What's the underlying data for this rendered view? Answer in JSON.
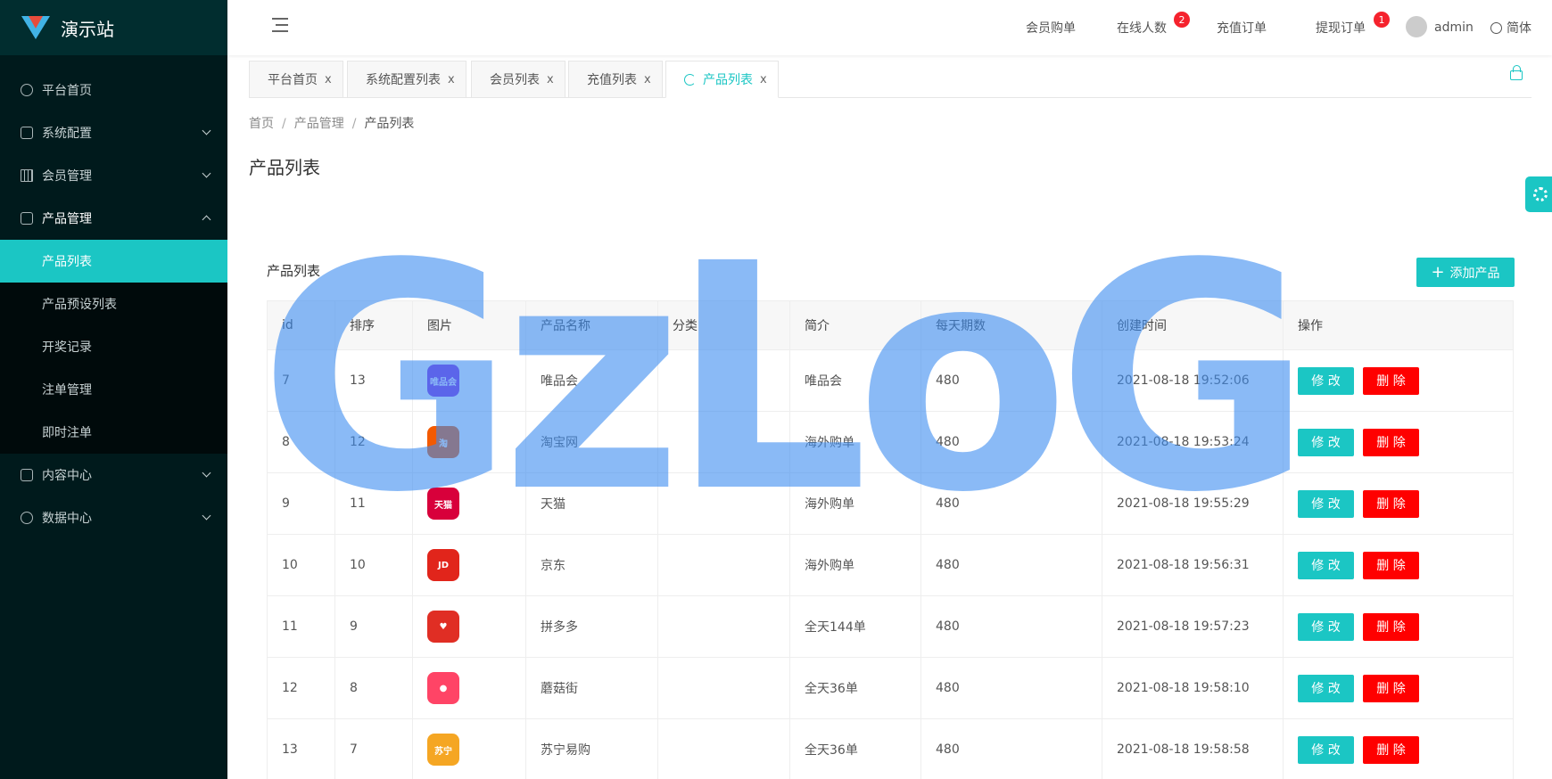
{
  "app": {
    "title": "演示站"
  },
  "sidebar": {
    "items": [
      {
        "label": "平台首页"
      },
      {
        "label": "系统配置"
      },
      {
        "label": "会员管理"
      },
      {
        "label": "产品管理"
      },
      {
        "label": "内容中心"
      },
      {
        "label": "数据中心"
      }
    ],
    "sub_items": [
      {
        "label": "产品列表"
      },
      {
        "label": "产品预设列表"
      },
      {
        "label": "开奖记录"
      },
      {
        "label": "注单管理"
      },
      {
        "label": "即时注单"
      }
    ]
  },
  "topbar": {
    "member_orders": "会员购单",
    "online_users": "在线人数",
    "online_badge": "2",
    "recharge_orders": "充值订单",
    "withdraw_orders": "提现订单",
    "withdraw_badge": "1",
    "user": "admin",
    "language": "简体"
  },
  "tabs": [
    {
      "label": "平台首页"
    },
    {
      "label": "系统配置列表"
    },
    {
      "label": "会员列表"
    },
    {
      "label": "充值列表"
    },
    {
      "label": "产品列表"
    }
  ],
  "tab_close": "x",
  "breadcrumb": {
    "home": "首页",
    "section": "产品管理",
    "current": "产品列表",
    "sep": "/"
  },
  "page_title": "产品列表",
  "card": {
    "title": "产品列表",
    "add_button": "添加产品",
    "add_icon": "+"
  },
  "table": {
    "columns": [
      "id",
      "排序",
      "图片",
      "产品名称",
      "分类",
      "简介",
      "每天期数",
      "创建时间",
      "操作"
    ],
    "edit_label": "修 改",
    "delete_label": "删 除",
    "rows": [
      {
        "id": "7",
        "sort": "13",
        "name": "唯品会",
        "category": "",
        "intro": "唯品会",
        "periods": "480",
        "created": "2021-08-18 19:52:06",
        "icon_text": "唯品会",
        "icon_color": "#8a2be2"
      },
      {
        "id": "8",
        "sort": "12",
        "name": "淘宝网",
        "category": "",
        "intro": "海外购单",
        "periods": "480",
        "created": "2021-08-18 19:53:24",
        "icon_text": "淘",
        "icon_color": "#f35a00"
      },
      {
        "id": "9",
        "sort": "11",
        "name": "天猫",
        "category": "",
        "intro": "海外购单",
        "periods": "480",
        "created": "2021-08-18 19:55:29",
        "icon_text": "天猫",
        "icon_color": "#d8003b"
      },
      {
        "id": "10",
        "sort": "10",
        "name": "京东",
        "category": "",
        "intro": "海外购单",
        "periods": "480",
        "created": "2021-08-18 19:56:31",
        "icon_text": "JD",
        "icon_color": "#e1251b"
      },
      {
        "id": "11",
        "sort": "9",
        "name": "拼多多",
        "category": "",
        "intro": "全天144单",
        "periods": "480",
        "created": "2021-08-18 19:57:23",
        "icon_text": "♥",
        "icon_color": "#e02e24"
      },
      {
        "id": "12",
        "sort": "8",
        "name": "蘑菇街",
        "category": "",
        "intro": "全天36单",
        "periods": "480",
        "created": "2021-08-18 19:58:10",
        "icon_text": "●",
        "icon_color": "#ff4466"
      },
      {
        "id": "13",
        "sort": "7",
        "name": "苏宁易购",
        "category": "",
        "intro": "全天36单",
        "periods": "480",
        "created": "2021-08-18 19:58:58",
        "icon_text": "苏宁",
        "icon_color": "#f5a623"
      }
    ]
  },
  "watermark": "GzLoG"
}
